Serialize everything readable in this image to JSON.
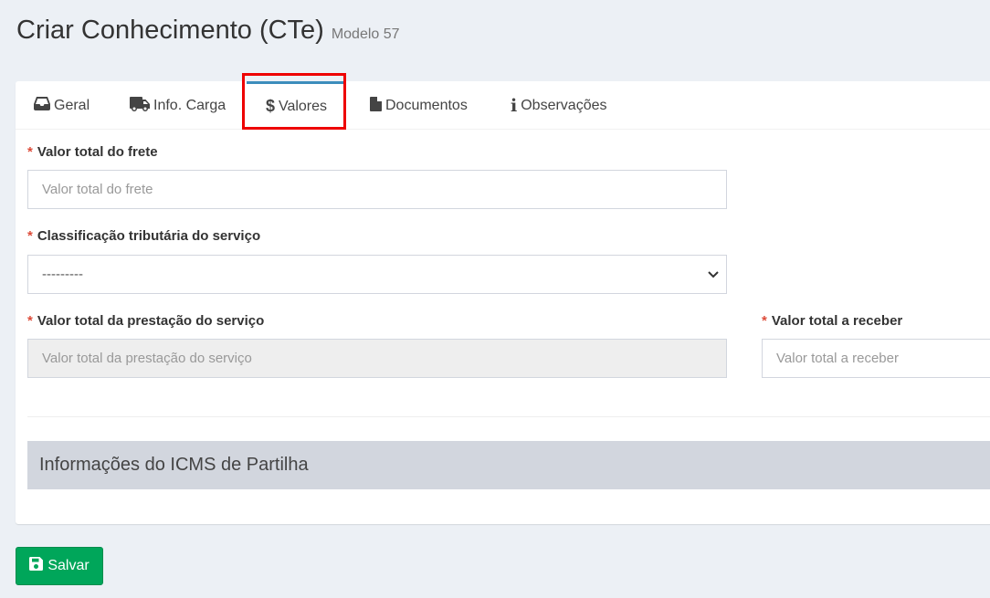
{
  "page": {
    "title": "Criar Conhecimento (CTe)",
    "subtitle": "Modelo 57"
  },
  "tabs": [
    {
      "label": "Geral",
      "icon": "inbox-icon"
    },
    {
      "label": "Info. Carga",
      "icon": "truck-icon"
    },
    {
      "label": "Valores",
      "icon": "dollar-icon",
      "active": true
    },
    {
      "label": "Documentos",
      "icon": "file-icon"
    },
    {
      "label": "Observações",
      "icon": "info-icon"
    }
  ],
  "form": {
    "required_marker": "*",
    "valor_total_frete": {
      "label": "Valor total do frete",
      "placeholder": "Valor total do frete",
      "value": ""
    },
    "classificacao_tributaria": {
      "label": "Classificação tributária do serviço",
      "selected": "---------"
    },
    "valor_total_prestacao": {
      "label": "Valor total da prestação do serviço",
      "placeholder": "Valor total da prestação do serviço",
      "value": ""
    },
    "valor_total_receber": {
      "label": "Valor total a receber",
      "placeholder": "Valor total a receber",
      "value": ""
    }
  },
  "section": {
    "icms_partilha_title": "Informações do ICMS de Partilha"
  },
  "actions": {
    "save_label": "Salvar",
    "save_icon": "floppy-disk-icon"
  },
  "colors": {
    "accent": "#3c8dbc",
    "save_button": "#00a65a",
    "required": "#dd4b39",
    "highlight": "#ee0000"
  }
}
